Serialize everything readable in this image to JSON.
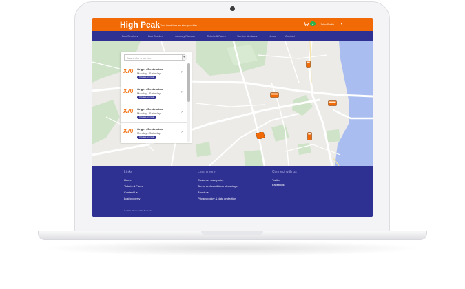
{
  "header": {
    "brand": "High Peak",
    "tagline": "Your local bus service provider",
    "cart_count": "2",
    "user_name": "John Smith",
    "user_caret": "▼",
    "color": "#f26a05"
  },
  "nav": {
    "items": [
      "Bus Services",
      "Bus Tracker",
      "Journey Planner",
      "Tickets & Fares",
      "Service Updates",
      "News",
      "Contact"
    ],
    "color": "#2f3192"
  },
  "search": {
    "placeholder": "Search for a service",
    "button_glyph": "▾"
  },
  "routes": [
    {
      "number": "X70",
      "title": "Origin - Destination",
      "days": "Monday - Saturday",
      "badge": "3 buses on route"
    },
    {
      "number": "X70",
      "title": "Origin - Destination",
      "days": "Monday - Saturday",
      "badge": "3 buses on route"
    },
    {
      "number": "X70",
      "title": "Origin - Destination",
      "days": "Monday - Saturday",
      "badge": "3 buses on route"
    },
    {
      "number": "X70",
      "title": "Origin - Destination",
      "days": "Monday - Saturday",
      "badge": "3 buses on route"
    }
  ],
  "route_chevron": "›",
  "map": {
    "bus_icon": "bus-icon"
  },
  "footer": {
    "columns": [
      {
        "heading": "Links",
        "links": [
          "Home",
          "Tickets & Fares",
          "Contact Us",
          "Lost property"
        ]
      },
      {
        "heading": "Learn more",
        "links": [
          "Customer care policy",
          "Terms and conditions of carriage",
          "About us",
          "Privacy policy & data protection"
        ]
      },
      {
        "heading": "Connect with us",
        "links": [
          "Twitter",
          "Facebook"
        ]
      }
    ],
    "copyright": "© 2018 - Powered by BusHub"
  }
}
